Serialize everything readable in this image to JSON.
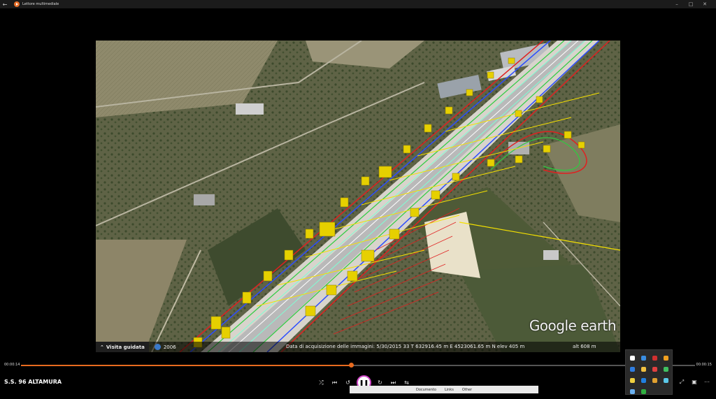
{
  "window": {
    "title": "Lettore multimediale",
    "back_icon": "back-arrow-icon",
    "minimize": "–",
    "maximize": "□",
    "close": "✕"
  },
  "video": {
    "google_earth_logo": "Google earth",
    "tour_label": "Visita guidata",
    "year": "2006",
    "status_info": "Data di acquisizione delle immagini: 5/30/2015    33 T 632916.45 m E 4523061.65 m N  elev  405 m",
    "altitude": "alt   608 m"
  },
  "playback": {
    "current_time": "00:00:14",
    "total_time": "00:00:15",
    "progress": 0.49
  },
  "media_title": "S.S. 96 ALTAMURA",
  "controls": {
    "shuffle": "shuffle-icon",
    "previous": "previous-icon",
    "rewind": "rewind-10-icon",
    "pause": "pause-icon",
    "forward": "forward-30-icon",
    "next": "next-icon",
    "repeat": "repeat-icon"
  },
  "taskbar_tabs": [
    "Documento",
    "Links",
    "Other"
  ],
  "colors": {
    "accent": "#e86a1f",
    "play_ring": "#d046c8"
  }
}
